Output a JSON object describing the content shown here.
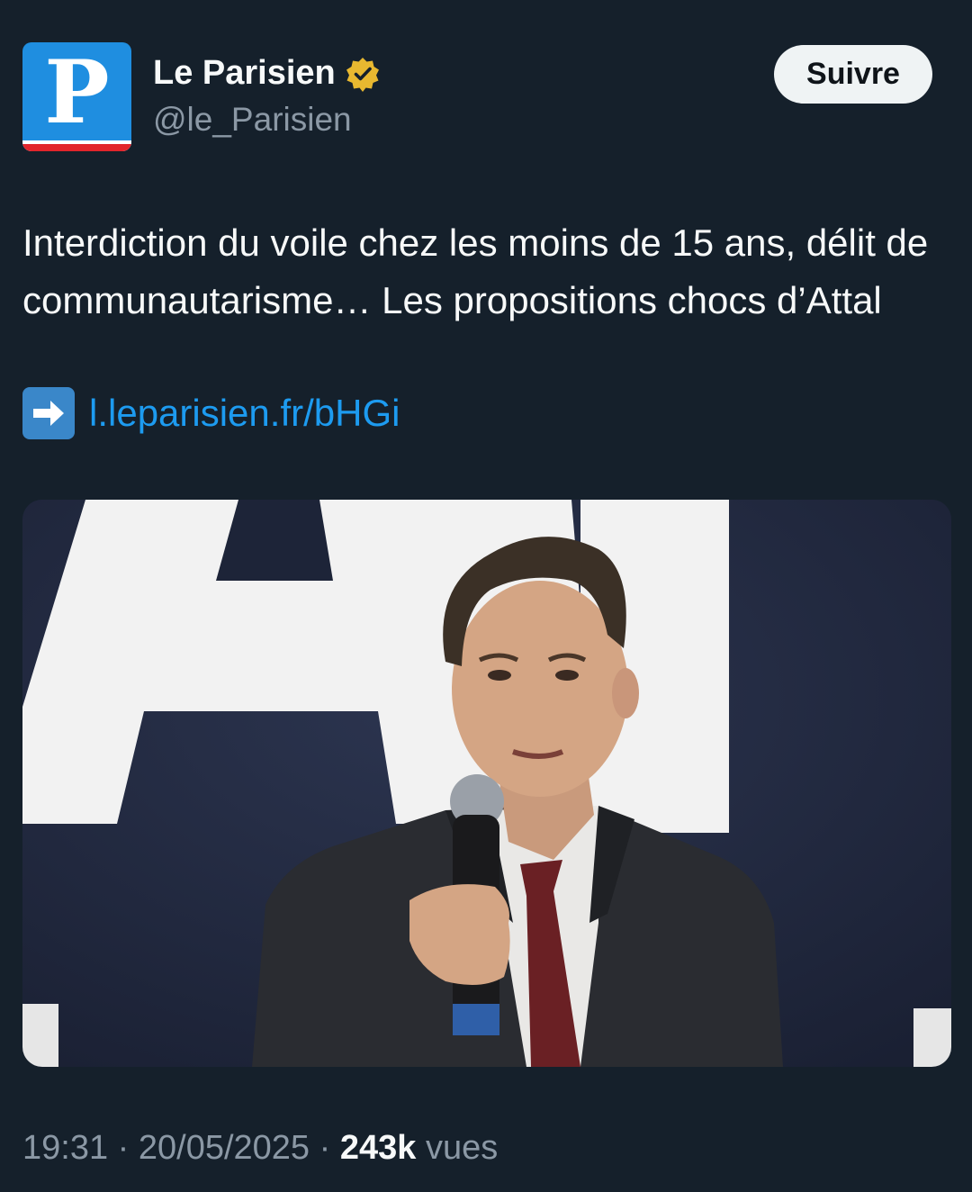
{
  "account": {
    "avatar_letter": "P",
    "name": "Le Parisien",
    "handle": "@le_Parisien",
    "verified_icon": "gold-verified-badge-icon",
    "brand_color": "#1f8ee0",
    "verified_color": "#e8b830"
  },
  "follow_button": {
    "label": "Suivre"
  },
  "tweet": {
    "text": "Interdiction du voile chez les moins de 15 ans, délit de communautarisme… Les propositions chocs d’Attal",
    "link_icon": "right-arrow-emoji-icon",
    "link_text": "l.leparisien.fr/bHGi",
    "link_color": "#1d9bf0"
  },
  "photo": {
    "subject": "speaker-holding-microphone"
  },
  "meta": {
    "time": "19:31",
    "separator": " · ",
    "date": "20/05/2025",
    "views_count": "243k",
    "views_label": "vues"
  }
}
